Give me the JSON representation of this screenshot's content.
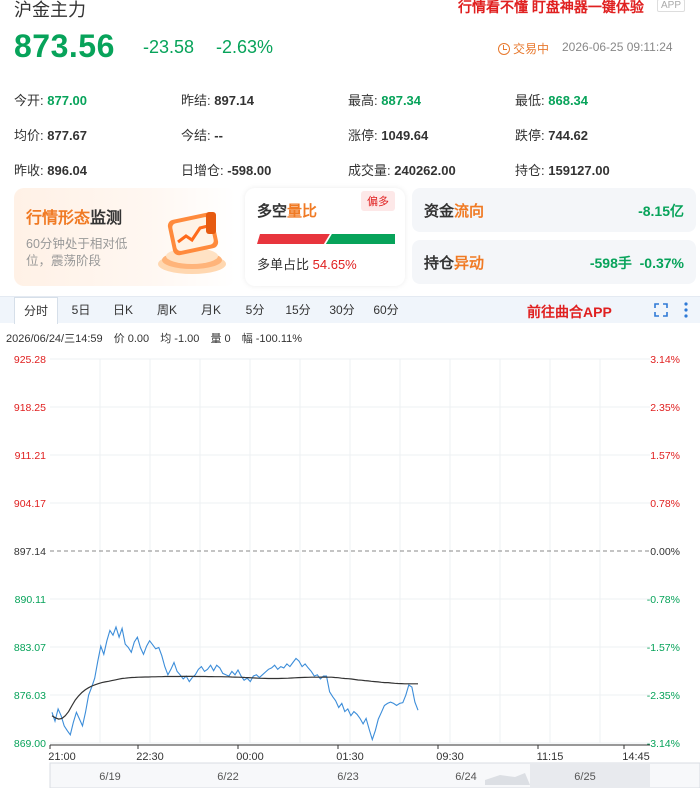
{
  "header": {
    "title": "沪金主力",
    "promo": "行情看不懂 盯盘神器一键体验",
    "app_tag": "APP"
  },
  "quote": {
    "price": "873.56",
    "change": "-23.58",
    "change_pct": "-2.63%",
    "status": "交易中",
    "timestamp": "2026-06-25 09:11:24"
  },
  "stats": [
    [
      {
        "label": "今开:",
        "value": "877.00",
        "color": "green"
      },
      {
        "label": "昨结:",
        "value": "897.14",
        "color": ""
      },
      {
        "label": "最高:",
        "value": "887.34",
        "color": "green"
      },
      {
        "label": "最低:",
        "value": "868.34",
        "color": "green"
      }
    ],
    [
      {
        "label": "均价:",
        "value": "877.67",
        "color": ""
      },
      {
        "label": "今结:",
        "value": "--",
        "color": ""
      },
      {
        "label": "涨停:",
        "value": "1049.64",
        "color": ""
      },
      {
        "label": "跌停:",
        "value": "744.62",
        "color": ""
      }
    ],
    [
      {
        "label": "昨收:",
        "value": "896.04",
        "color": ""
      },
      {
        "label": "日增仓:",
        "value": "-598.00",
        "color": ""
      },
      {
        "label": "成交量:",
        "value": "240262.00",
        "color": ""
      },
      {
        "label": "持仓:",
        "value": "159127.00",
        "color": ""
      }
    ]
  ],
  "cards": {
    "pattern": {
      "title_a": "行情形态",
      "title_b": "监测",
      "desc": "60分钟处于相对低位，震荡阶段"
    },
    "longshort": {
      "title_a": "多空",
      "title_b": "量比",
      "tag": "偏多",
      "label": "多单占比",
      "pct": "54.65%",
      "long_ratio": 0.5465
    },
    "flow": {
      "title_a": "资金",
      "title_b": "流向",
      "value": "-8.15亿"
    },
    "position": {
      "title_a": "持仓",
      "title_b": "异动",
      "value": "-598手",
      "value2": "-0.37%"
    }
  },
  "tabs": [
    "分时",
    "5日",
    "日K",
    "周K",
    "月K",
    "5分",
    "15分",
    "30分",
    "60分"
  ],
  "active_tab": 0,
  "goto_app": "前往曲合APP",
  "info": {
    "date": "2026/06/24/三14:59",
    "price": "价 0.00",
    "avg": "均 -1.00",
    "vol": "量 0",
    "amp": "幅 -100.11%"
  },
  "chart_data": {
    "type": "line",
    "y_labels_left": [
      "925.28",
      "918.25",
      "911.21",
      "904.17",
      "897.14",
      "890.11",
      "883.07",
      "876.03",
      "869.00"
    ],
    "y_labels_right": [
      "3.14%",
      "2.35%",
      "1.57%",
      "0.78%",
      "0.00%",
      "-0.78%",
      "-1.57%",
      "-2.35%",
      "-3.14%"
    ],
    "ylim": [
      869.0,
      925.28
    ],
    "prev_settle": 897.14,
    "x_ticks": [
      "21:00",
      "22:30",
      "00:00",
      "01:30",
      "09:30",
      "11:15",
      "14:45"
    ],
    "day_labels": [
      "6/19",
      "6/22",
      "6/23",
      "6/24",
      "6/25"
    ],
    "series": [
      {
        "values": [
          873.5,
          872.2,
          874.0,
          873.0,
          871.5,
          870.8,
          870.2,
          872.0,
          873.5,
          872.5,
          871.5,
          873.5,
          876.0,
          877.2,
          878.5,
          881.0,
          883.2,
          882.0,
          884.0,
          885.5,
          884.8,
          886.0,
          884.5,
          885.8,
          883.5,
          883.0,
          882.3,
          883.8,
          884.5,
          883.0,
          882.0,
          883.2,
          884.0,
          883.4,
          882.8,
          883.0,
          881.8,
          880.2,
          879.0,
          879.8,
          880.8,
          879.5,
          879.0,
          878.4,
          878.8,
          878.0,
          878.6,
          879.0,
          879.8,
          880.2,
          879.5,
          879.8,
          880.4,
          879.6,
          880.4,
          880.0,
          879.2,
          879.0,
          878.8,
          879.5,
          879.0,
          879.7,
          878.8,
          878.2,
          878.5,
          878.0,
          878.8,
          879.0,
          878.6,
          879.0,
          879.4,
          879.8,
          880.0,
          880.4,
          879.8,
          880.2,
          880.0,
          880.6,
          880.2,
          880.8,
          881.4,
          881.0,
          880.2,
          880.6,
          880.0,
          879.5,
          878.8,
          879.0,
          878.4,
          878.8,
          878.8,
          876.5,
          875.8,
          875.2,
          874.2,
          874.8,
          873.6,
          874.0,
          873.0,
          873.6,
          873.2,
          872.6,
          871.8,
          872.6,
          871.0,
          869.5,
          870.8,
          872.5,
          873.5,
          874.5,
          874.8,
          875.0,
          874.8,
          874.5,
          874.8,
          874.9,
          876.0,
          877.5,
          877.2,
          875.0,
          873.8
        ]
      },
      {
        "values": [
          873.0,
          872.7,
          872.5,
          872.6,
          873.0,
          873.6,
          874.5,
          875.3,
          875.9,
          876.4,
          876.8,
          877.1,
          877.35,
          877.55,
          877.7,
          877.85,
          877.95,
          878.05,
          878.15,
          878.25,
          878.35,
          878.45,
          878.5,
          878.55,
          878.6,
          878.62,
          878.64,
          878.66,
          878.68,
          878.68,
          878.7,
          878.7,
          878.72,
          878.72,
          878.74,
          878.74,
          878.74,
          878.75,
          878.75,
          878.76,
          878.76,
          878.76,
          878.76,
          878.75,
          878.75,
          878.74,
          878.74,
          878.73,
          878.73,
          878.72,
          878.72,
          878.71,
          878.7,
          878.7,
          878.68,
          878.66,
          878.65,
          878.63,
          878.6,
          878.58,
          878.55,
          878.52,
          878.5,
          878.48,
          878.47,
          878.46,
          878.45,
          878.45,
          878.45,
          878.47,
          878.48,
          878.5,
          878.52,
          878.55,
          878.58,
          878.6,
          878.62,
          878.63,
          878.64,
          878.65,
          878.65,
          878.66,
          878.66,
          878.65,
          878.64,
          878.6,
          878.57,
          878.5,
          878.45,
          878.42,
          878.38,
          878.3,
          878.24,
          878.2,
          878.15,
          878.1,
          878.05,
          878.0,
          877.95,
          877.9,
          877.85,
          877.85,
          877.8,
          877.75,
          877.72,
          877.7,
          877.68,
          877.67,
          877.67,
          877.67,
          877.67
        ]
      }
    ]
  },
  "colors": {
    "up": "#e02020",
    "down": "#07a35a",
    "price_line": "#3c8dd9",
    "avg_line": "#333333"
  }
}
